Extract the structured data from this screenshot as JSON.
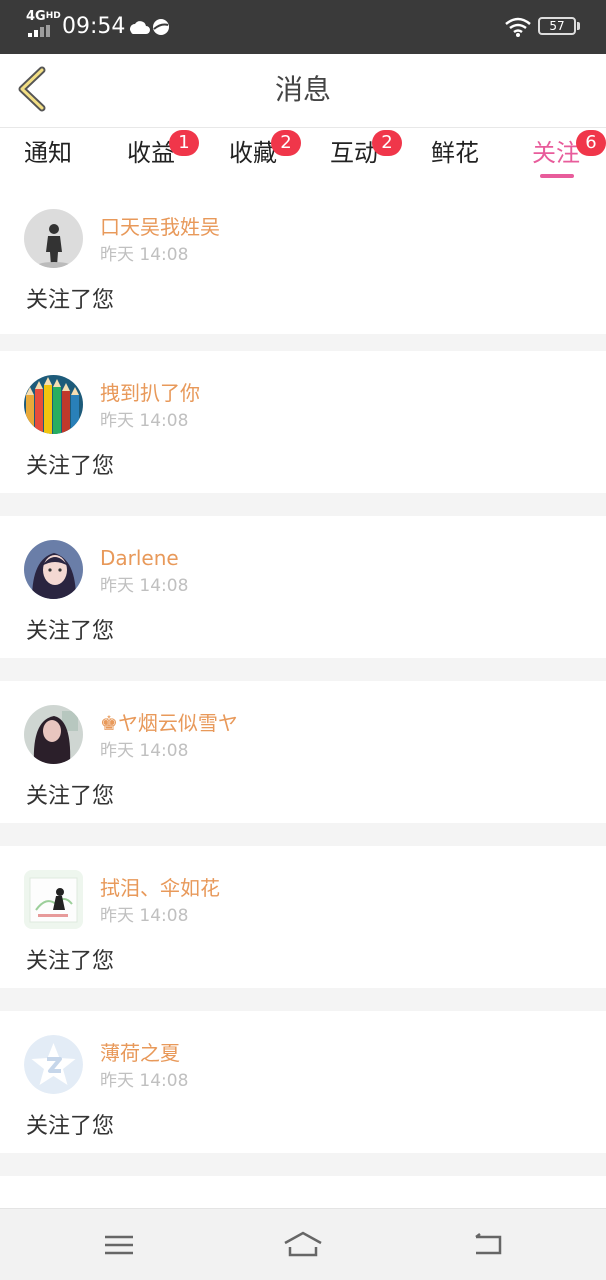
{
  "status_bar": {
    "network": "4G",
    "network_hd": "HD",
    "time": "09:54",
    "battery": "57"
  },
  "header": {
    "title": "消息",
    "back_icon": "chevron-left-icon"
  },
  "tabs": [
    {
      "label": "通知",
      "badge": ""
    },
    {
      "label": "收益",
      "badge": "1"
    },
    {
      "label": "收藏",
      "badge": "2"
    },
    {
      "label": "互动",
      "badge": "2"
    },
    {
      "label": "鲜花",
      "badge": ""
    },
    {
      "label": "关注",
      "badge": "6",
      "active": true
    }
  ],
  "feed": [
    {
      "name": "口天吴我姓吴",
      "time": "昨天 14:08",
      "message": "关注了您",
      "avatar": "person-silhouette"
    },
    {
      "name": "拽到扒了你",
      "time": "昨天 14:08",
      "message": "关注了您",
      "avatar": "colored-pencils"
    },
    {
      "name": "Darlene",
      "time": "昨天 14:08",
      "message": "关注了您",
      "avatar": "girl-portrait"
    },
    {
      "name": "ヤ烟云似雪ヤ",
      "time": "昨天 14:08",
      "message": "关注了您",
      "avatar": "girl-dark-hair",
      "crown": "♚"
    },
    {
      "name": "拭泪、伞如花",
      "time": "昨天 14:08",
      "message": "关注了您",
      "avatar": "green-illustration"
    },
    {
      "name": "薄荷之夏",
      "time": "昨天 14:08",
      "message": "关注了您",
      "avatar": "default-star-avatar"
    }
  ],
  "colors": {
    "accent": "#e85c9b",
    "username": "#e8995a",
    "badge": "#f0364a",
    "status_bar": "#3a3a3a"
  },
  "bottom_nav": [
    "menu-icon",
    "home-icon",
    "back-icon"
  ]
}
